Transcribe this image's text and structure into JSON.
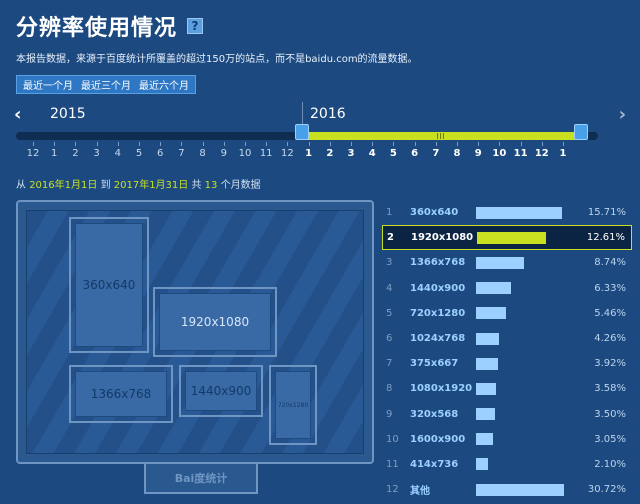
{
  "header": {
    "title": "分辨率使用情况",
    "help_icon": "?",
    "description": "本报告数据，来源于百度统计所覆盖的超过150万的站点，而不是baidu.com的流量数据。"
  },
  "range_buttons": [
    "最近一个月",
    "最近三个月",
    "最近六个月"
  ],
  "timeline": {
    "left_arrow": "‹",
    "right_arrow": "›",
    "year_left": "2015",
    "year_right": "2016",
    "months": [
      "12",
      "1",
      "2",
      "3",
      "4",
      "5",
      "6",
      "7",
      "8",
      "9",
      "10",
      "11",
      "12",
      "1",
      "2",
      "3",
      "4",
      "5",
      "6",
      "7",
      "8",
      "9",
      "10",
      "11",
      "12",
      "1"
    ],
    "active_from_index": 13
  },
  "summary": {
    "prefix": "从",
    "start": "2016年1月1日",
    "to": "到",
    "end": "2017年1月31日",
    "total": "共",
    "count": "13",
    "suffix": "个月数据"
  },
  "monitor": {
    "brand": "Bai度统计",
    "boxes": [
      "360x640",
      "1920x1080",
      "1366x768",
      "1440x900",
      "720x1280"
    ]
  },
  "ranking": [
    {
      "rank": "1",
      "resolution": "360x640",
      "percent": "15.71%",
      "value": 15.71
    },
    {
      "rank": "2",
      "resolution": "1920x1080",
      "percent": "12.61%",
      "value": 12.61,
      "highlight": true
    },
    {
      "rank": "3",
      "resolution": "1366x768",
      "percent": "8.74%",
      "value": 8.74
    },
    {
      "rank": "4",
      "resolution": "1440x900",
      "percent": "6.33%",
      "value": 6.33
    },
    {
      "rank": "5",
      "resolution": "720x1280",
      "percent": "5.46%",
      "value": 5.46
    },
    {
      "rank": "6",
      "resolution": "1024x768",
      "percent": "4.26%",
      "value": 4.26
    },
    {
      "rank": "7",
      "resolution": "375x667",
      "percent": "3.92%",
      "value": 3.92
    },
    {
      "rank": "8",
      "resolution": "1080x1920",
      "percent": "3.58%",
      "value": 3.58
    },
    {
      "rank": "9",
      "resolution": "320x568",
      "percent": "3.50%",
      "value": 3.5
    },
    {
      "rank": "10",
      "resolution": "1600x900",
      "percent": "3.05%",
      "value": 3.05
    },
    {
      "rank": "11",
      "resolution": "414x736",
      "percent": "2.10%",
      "value": 2.1
    },
    {
      "rank": "12",
      "resolution": "其他",
      "percent": "30.72%",
      "value": 30.72
    }
  ],
  "colors": {
    "background": "#1c4a80",
    "accent": "#c8e020",
    "bar": "#9cd0ff",
    "text_light": "#ffffff"
  }
}
